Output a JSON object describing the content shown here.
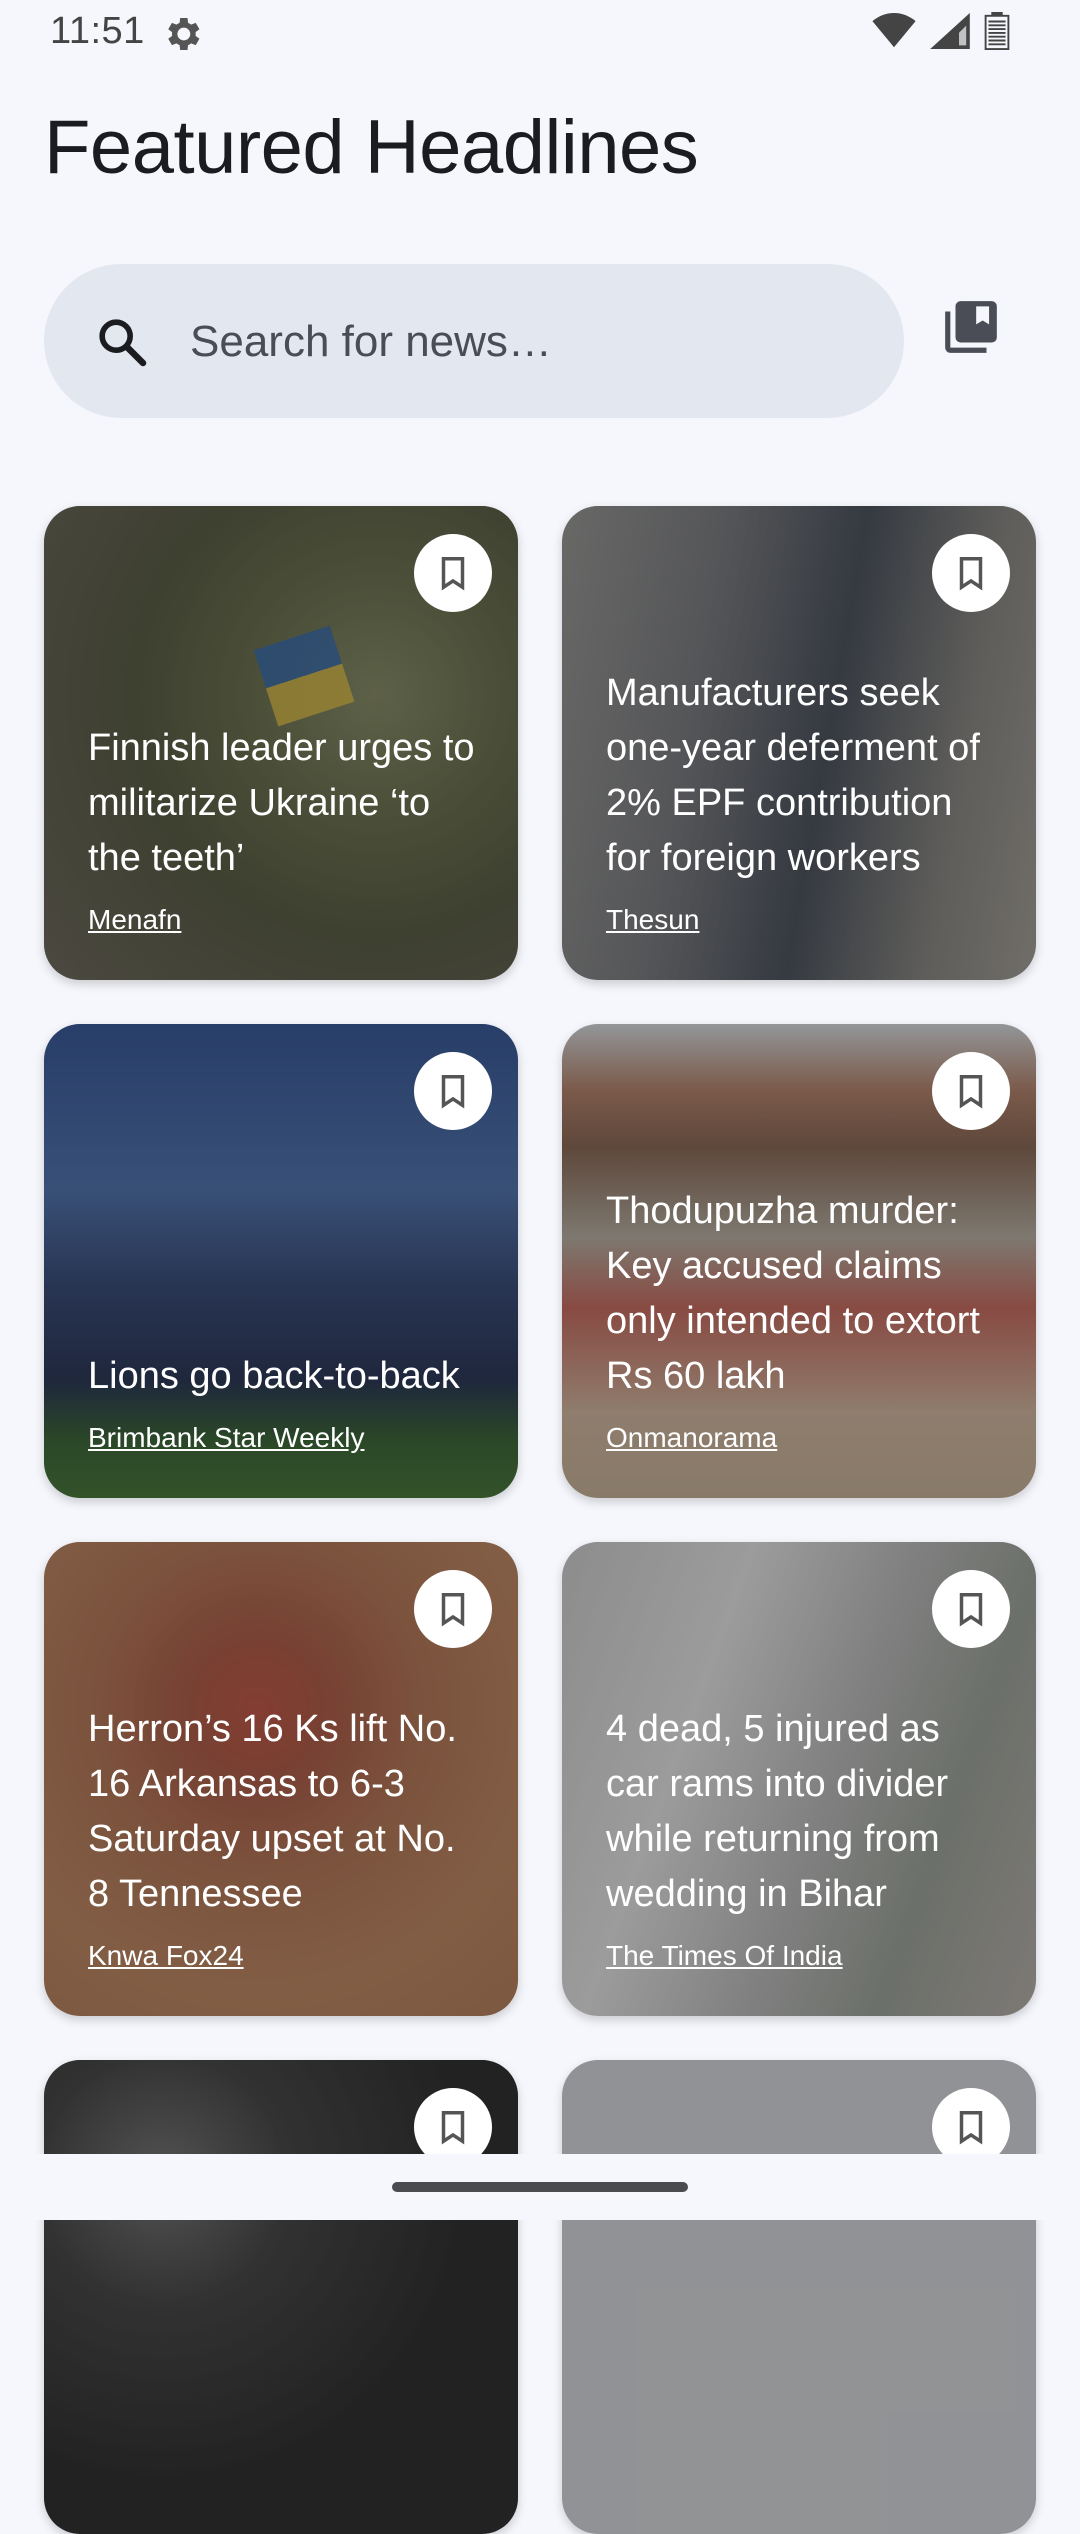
{
  "status": {
    "time": "11:51"
  },
  "header": {
    "title": "Featured Headlines"
  },
  "search": {
    "placeholder": "Search for news…",
    "value": ""
  },
  "icons": {
    "search": "search-icon",
    "bookmarks": "bookmarks-icon",
    "card_bookmark": "bookmark-outline-icon",
    "settings": "gear-icon",
    "wifi": "wifi-icon",
    "signal": "signal-icon",
    "battery": "battery-icon"
  },
  "colors": {
    "background": "#f5f7fc",
    "search_background": "#e3e7ef",
    "card_text": "#ffffff"
  },
  "cards": [
    {
      "title": "Finnish leader urges to militarize Ukraine ‘to the teeth’",
      "source": "Menafn"
    },
    {
      "title": "Manufacturers seek one-year deferment of 2% EPF contribution for foreign workers",
      "source": "Thesun"
    },
    {
      "title": "Lions go back-to-back",
      "source": "Brimbank Star Weekly"
    },
    {
      "title": "Thodupuzha murder: Key accused claims only intended to extort Rs 60 lakh",
      "source": "Onmanorama"
    },
    {
      "title": "Herron’s 16 Ks lift No. 16 Arkansas to 6-3 Saturday upset at No. 8 Tennessee",
      "source": "Knwa Fox24"
    },
    {
      "title": "4 dead, 5 injured as car rams into divider while returning from wedding in Bihar",
      "source": "The Times Of India"
    },
    {
      "title": "",
      "source": ""
    },
    {
      "title": "",
      "source": ""
    }
  ]
}
